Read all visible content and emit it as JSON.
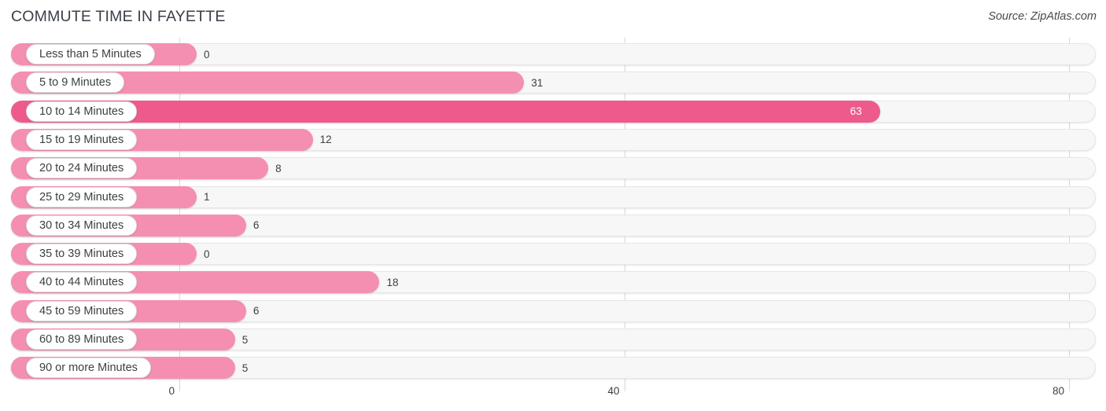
{
  "header": {
    "title": "COMMUTE TIME IN FAYETTE",
    "source": "Source: ZipAtlas.com"
  },
  "colors": {
    "bar": "#f48fb1",
    "bar_max": "#ef5a8c",
    "track": "#f7f7f7",
    "gridline": "#d9d9d9",
    "text": "#3c4043"
  },
  "chart_data": {
    "type": "bar",
    "orientation": "horizontal",
    "title": "COMMUTE TIME IN FAYETTE",
    "xlabel": "",
    "ylabel": "",
    "xlim": [
      0,
      80
    ],
    "ticks": [
      "0",
      "40",
      "80"
    ],
    "tick_values": [
      0,
      40,
      80
    ],
    "grid": true,
    "legend": null,
    "categories": [
      "Less than 5 Minutes",
      "5 to 9 Minutes",
      "10 to 14 Minutes",
      "15 to 19 Minutes",
      "20 to 24 Minutes",
      "25 to 29 Minutes",
      "30 to 34 Minutes",
      "35 to 39 Minutes",
      "40 to 44 Minutes",
      "45 to 59 Minutes",
      "60 to 89 Minutes",
      "90 or more Minutes"
    ],
    "values": [
      0,
      31,
      63,
      12,
      8,
      1,
      6,
      0,
      18,
      6,
      5,
      5
    ],
    "value_labels": [
      "0",
      "31",
      "63",
      "12",
      "8",
      "1",
      "6",
      "0",
      "18",
      "6",
      "5",
      "5"
    ],
    "max_value": 63
  }
}
